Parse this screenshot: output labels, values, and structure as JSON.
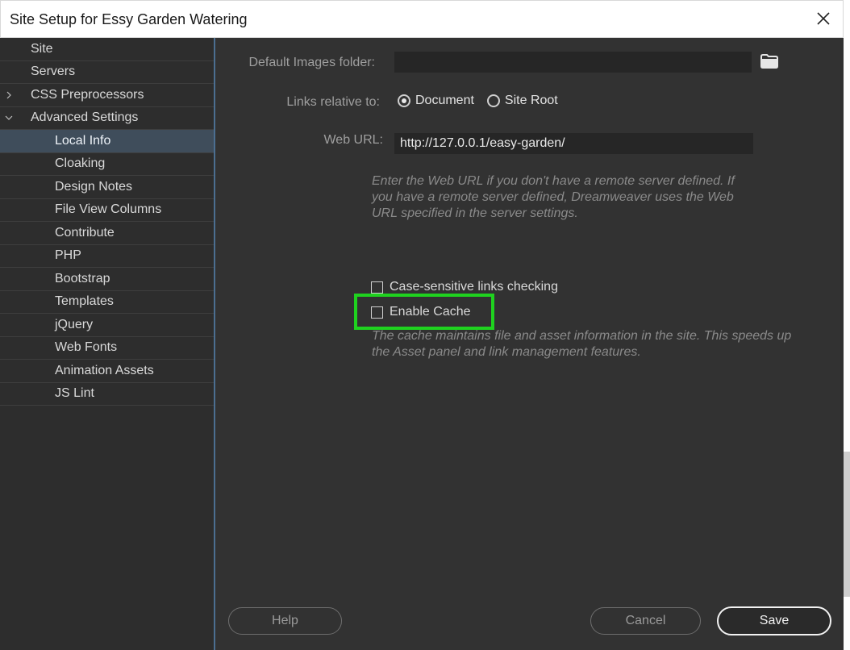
{
  "window": {
    "title": "Site Setup for Essy Garden Watering"
  },
  "sidebar": {
    "items": [
      {
        "label": "Site",
        "level": 0,
        "expander": "none",
        "selected": false
      },
      {
        "label": "Servers",
        "level": 0,
        "expander": "none",
        "selected": false
      },
      {
        "label": "CSS Preprocessors",
        "level": 0,
        "expander": "collapsed",
        "selected": false
      },
      {
        "label": "Advanced Settings",
        "level": 0,
        "expander": "expanded",
        "selected": false
      },
      {
        "label": "Local Info",
        "level": 1,
        "expander": "none",
        "selected": true
      },
      {
        "label": "Cloaking",
        "level": 1,
        "expander": "none",
        "selected": false
      },
      {
        "label": "Design Notes",
        "level": 1,
        "expander": "none",
        "selected": false
      },
      {
        "label": "File View Columns",
        "level": 1,
        "expander": "none",
        "selected": false
      },
      {
        "label": "Contribute",
        "level": 1,
        "expander": "none",
        "selected": false
      },
      {
        "label": "PHP",
        "level": 1,
        "expander": "none",
        "selected": false
      },
      {
        "label": "Bootstrap",
        "level": 1,
        "expander": "none",
        "selected": false
      },
      {
        "label": "Templates",
        "level": 1,
        "expander": "none",
        "selected": false
      },
      {
        "label": "jQuery",
        "level": 1,
        "expander": "none",
        "selected": false
      },
      {
        "label": "Web Fonts",
        "level": 1,
        "expander": "none",
        "selected": false
      },
      {
        "label": "Animation Assets",
        "level": 1,
        "expander": "none",
        "selected": false
      },
      {
        "label": "JS Lint",
        "level": 1,
        "expander": "none",
        "selected": false
      }
    ]
  },
  "local_info": {
    "default_images_label": "Default Images folder:",
    "default_images_value": "",
    "links_relative_label": "Links relative to:",
    "radio_document": "Document",
    "radio_site_root": "Site Root",
    "links_relative_selected": "Document",
    "web_url_label": "Web URL:",
    "web_url_value": "http://127.0.0.1/easy-garden/",
    "web_url_hint_lines": [
      "Enter the Web URL if you don't have a remote server defined. If",
      "you have a remote server defined, Dreamweaver uses the Web",
      "URL specified in the server settings."
    ],
    "case_sensitive_label": "Case-sensitive links checking",
    "case_sensitive_checked": false,
    "enable_cache_label": "Enable Cache",
    "enable_cache_checked": false,
    "cache_hint_lines": [
      "The cache maintains file and asset information in the site. This speeds up",
      "the Asset panel and link management features."
    ]
  },
  "buttons": {
    "help": "Help",
    "cancel": "Cancel",
    "save": "Save"
  },
  "colors": {
    "highlight": "#1fd21f",
    "sidebar_selected": "#3f4d5b",
    "panel": "#323232"
  }
}
